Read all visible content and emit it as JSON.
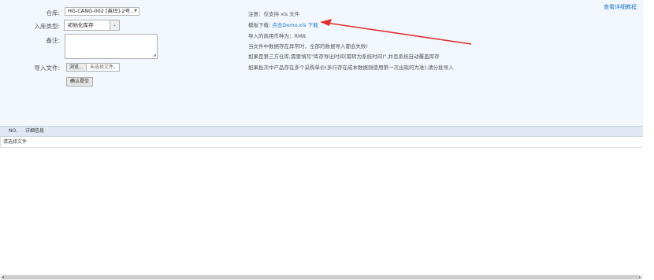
{
  "form": {
    "warehouse": {
      "label": "仓库:",
      "selected": "HG-CANG-002 [英玛]-2号..."
    },
    "inbound_type": {
      "label": "入库类型:",
      "selected": "初始化库存"
    },
    "note": {
      "label": "备注:",
      "value": ""
    },
    "import_file": {
      "label": "导入文件:",
      "browse_label": "浏览...",
      "no_file_text": "未选择文件。"
    },
    "submit_label": "确认提交"
  },
  "info": {
    "line1": "注意：仅支持 xls 文件",
    "line2_prefix": "模板下载:",
    "line2_link": "点击Demo.xls 下载",
    "line3": "导入的商用币种为：RMB",
    "line4": "当文件中数据存在异常时，全部的数据导入都会失败!",
    "line5": "如果是第三方仓库,需要填写\"库存导出时间(需转为系统时间)\",并且系统自动覆盖库存",
    "line6": "如果批次中产品存在多个采购单价(多行存在成本数据则使用第一次出现的为准),请分批导入"
  },
  "help_link": "查看详细教程",
  "table": {
    "headers": {
      "no": "NO.",
      "detail": "详细信息"
    },
    "empty_message": "请选择文件"
  },
  "colors": {
    "accent": "#2277cc",
    "arrow": "#e03030",
    "panel": "#f1f7fc"
  }
}
